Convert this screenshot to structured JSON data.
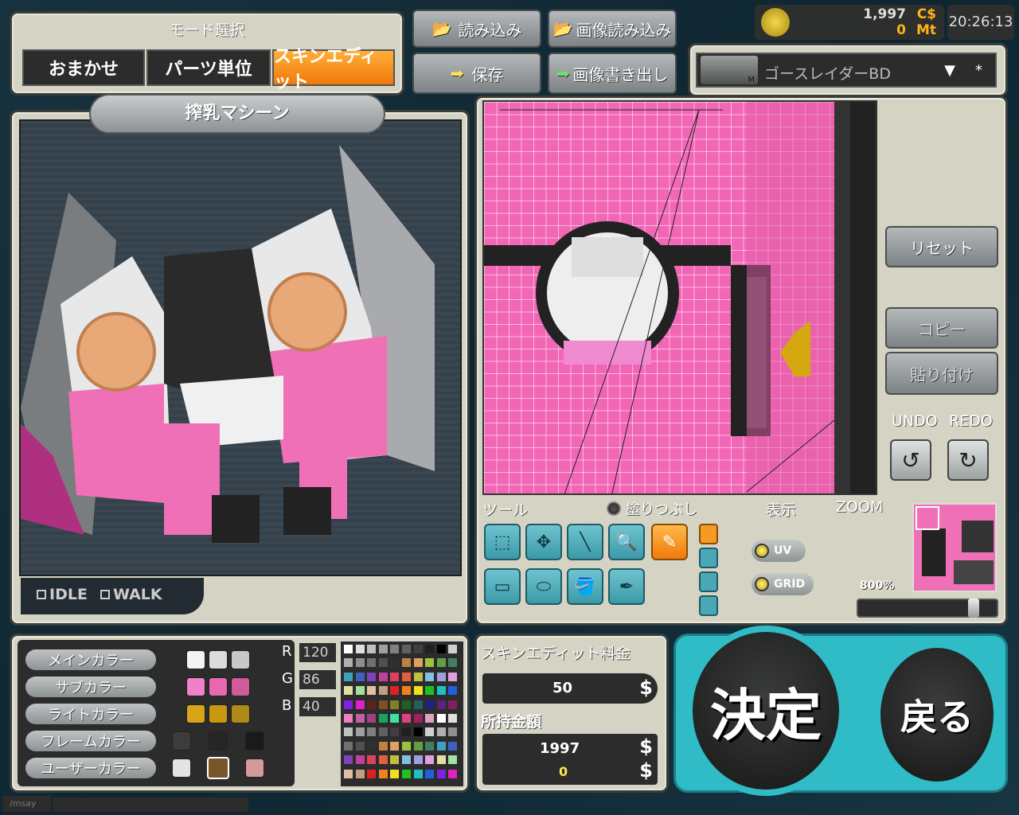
{
  "mode": {
    "title": "モード選択",
    "omakase": "おまかせ",
    "parts": "パーツ単位",
    "skin": "スキンエディット"
  },
  "file": {
    "load": "読み込み",
    "img_load": "画像読み込み",
    "save": "保存",
    "img_export": "画像書き出し"
  },
  "header": {
    "credits": "1,997",
    "credits_unit": "C$",
    "mt": "0",
    "mt_unit": "Mt",
    "time": "20:26:13"
  },
  "selector": {
    "name": "ゴースレイダーBD",
    "slot_badge": "M",
    "asterisk": "*"
  },
  "preview": {
    "title": "搾乳マシーン",
    "idle": "IDLE",
    "walk": "WALK"
  },
  "edit": {
    "reset": "リセット",
    "copy": "コピー",
    "paste": "貼り付け",
    "undo": "UNDO",
    "redo": "REDO"
  },
  "toolbar": {
    "tools_label": "ツール",
    "fill_label": "塗りつぶし",
    "display_label": "表示",
    "zoom_label": "ZOOM",
    "uv": "UV",
    "grid": "GRID",
    "zoom_value": "800%"
  },
  "colors": {
    "main_label": "メインカラー",
    "sub_label": "サブカラー",
    "light_label": "ライトカラー",
    "frame_label": "フレームカラー",
    "user_label": "ユーザーカラー",
    "r_label": "R",
    "g_label": "G",
    "b_label": "B",
    "r": "120",
    "g": "86",
    "b": "40"
  },
  "fee": {
    "title": "スキンエディット料金",
    "amount": "50",
    "currency": "$",
    "owned_label": "所持金額",
    "owned": "1997",
    "owned2": "0"
  },
  "actions": {
    "confirm": "決定",
    "back": "戻る"
  },
  "chat": {
    "placeholder": "/msay"
  },
  "palette_colors": {
    "main": [
      "#f4f4f4",
      "#dcdcdc",
      "#c8c8c8"
    ],
    "sub": [
      "#f080c8",
      "#e868b0",
      "#d05a9a"
    ],
    "light": [
      "#d8a418",
      "#c89810",
      "#b08a18"
    ],
    "frame": [
      "#3c3c3c",
      "#262626",
      "#1a1a1a"
    ],
    "user": [
      "#e4e4e4",
      "#785628",
      "#d49a98"
    ]
  }
}
